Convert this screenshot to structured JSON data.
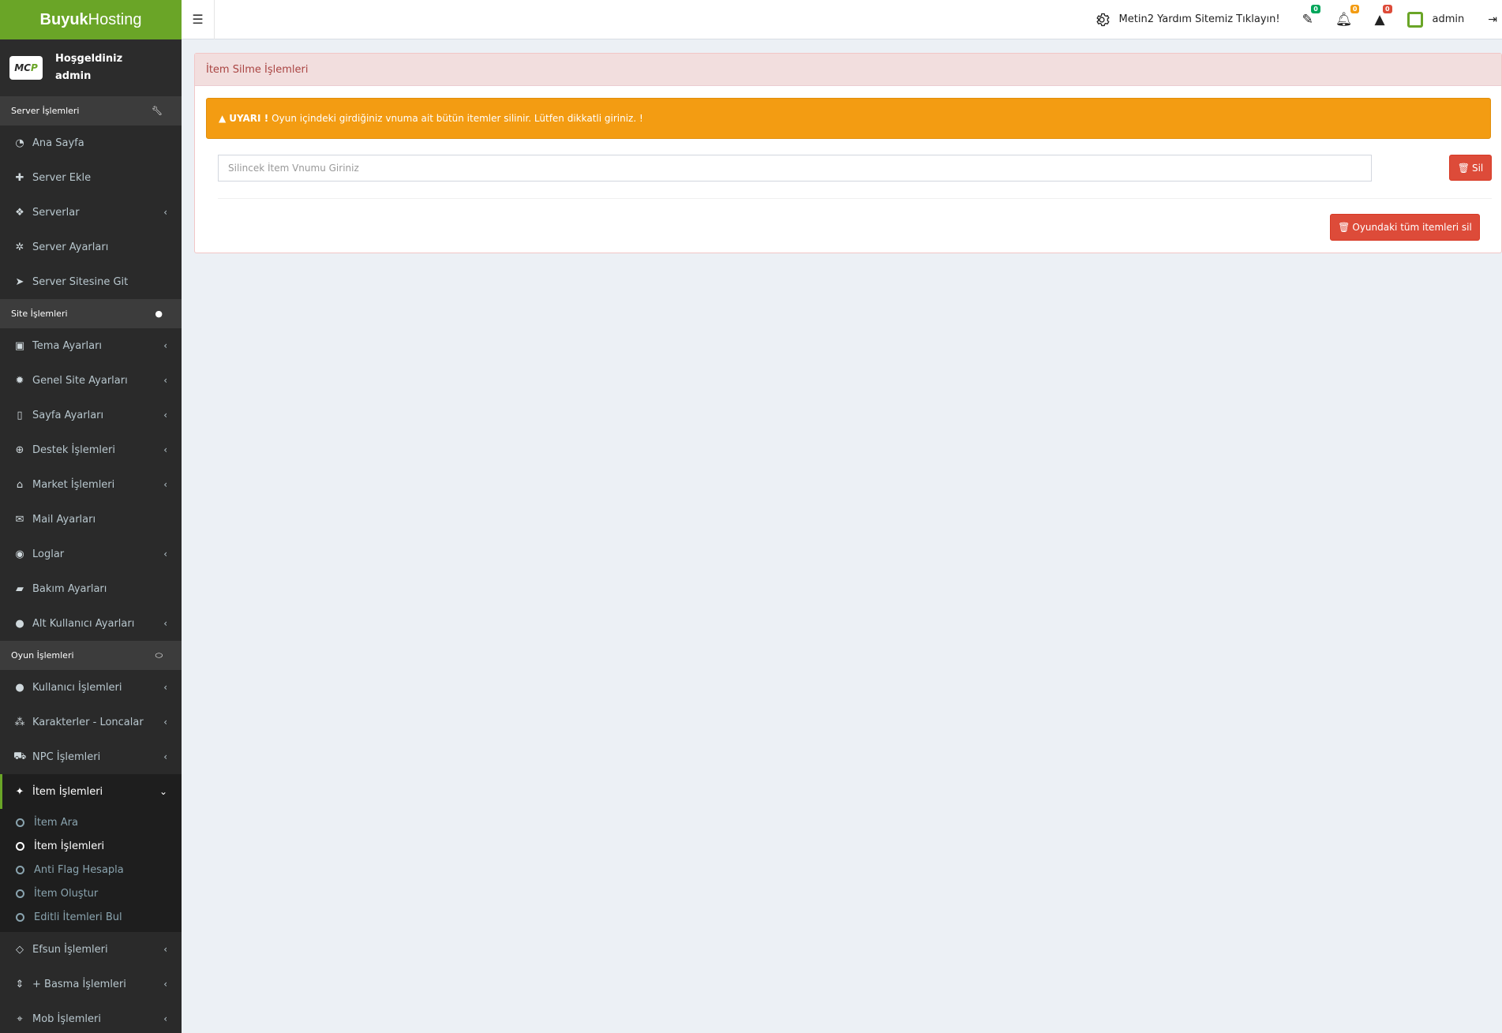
{
  "brand": {
    "bold": "Buyuk",
    "light": "Hosting"
  },
  "topbar": {
    "toggle_icon": "☰",
    "help_text": "Metin2 Yardım Sitemiz Tıklayın!",
    "ticket_badge": "0",
    "notif_badge": "0",
    "warning_badge": "0",
    "user_name": "admin"
  },
  "sidebar": {
    "user_logo_a": "MC",
    "user_logo_b": "P",
    "welcome": "Hoşgeldiniz",
    "username": "admin",
    "headers": {
      "server": "Server İşlemleri",
      "site": "Site İşlemleri",
      "game": "Oyun İşlemleri"
    },
    "server_items": [
      {
        "label": "Ana Sayfa",
        "icon": "dashboard-icon"
      },
      {
        "label": "Server Ekle",
        "icon": "plus-icon"
      },
      {
        "label": "Serverlar",
        "icon": "cubes-icon"
      },
      {
        "label": "Server Ayarları",
        "icon": "settings-icon"
      },
      {
        "label": "Server Sitesine Git",
        "icon": "paper-plane-icon"
      }
    ],
    "site_items": [
      {
        "label": "Tema Ayarları",
        "icon": "image-icon"
      },
      {
        "label": "Genel Site Ayarları",
        "icon": "gear-icon"
      },
      {
        "label": "Sayfa Ayarları",
        "icon": "file-icon"
      },
      {
        "label": "Destek İşlemleri",
        "icon": "globe-icon"
      },
      {
        "label": "Market İşlemleri",
        "icon": "basket-icon"
      },
      {
        "label": "Mail Ayarları",
        "icon": "envelope-icon"
      },
      {
        "label": "Loglar",
        "icon": "eye-icon"
      },
      {
        "label": "Bakım Ayarları",
        "icon": "eraser-icon"
      },
      {
        "label": "Alt Kullanıcı Ayarları",
        "icon": "user-icon"
      }
    ],
    "game_items": [
      {
        "label": "Kullanıcı İşlemleri",
        "icon": "user-icon"
      },
      {
        "label": "Karakterler - Loncalar",
        "icon": "users-icon"
      },
      {
        "label": "NPC İşlemleri",
        "icon": "cart-icon"
      }
    ],
    "active_item": "İtem İşlemleri",
    "sub_items": [
      "İtem Ara",
      "İtem İşlemleri",
      "Anti Flag Hesapla",
      "İtem Oluştur",
      "Editli İtemleri Bul"
    ],
    "after_items": [
      {
        "label": "Efsun İşlemleri",
        "icon": "diamond-icon"
      },
      {
        "label": "+ Basma İşlemleri",
        "icon": "sort-icon"
      },
      {
        "label": "Mob İşlemleri",
        "icon": "crosshairs-icon"
      }
    ]
  },
  "content": {
    "box_title": "İtem Silme İşlemleri",
    "alert_strong": "UYARI !",
    "alert_text": "Oyun içindeki girdiğiniz vnuma ait bütün itemler silinir. Lütfen dikkatli giriniz. !",
    "input_placeholder": "Silincek İtem Vnumu Giriniz",
    "delete_label": "Sil",
    "delete_all_label": "Oyundaki tüm itemleri sil"
  }
}
